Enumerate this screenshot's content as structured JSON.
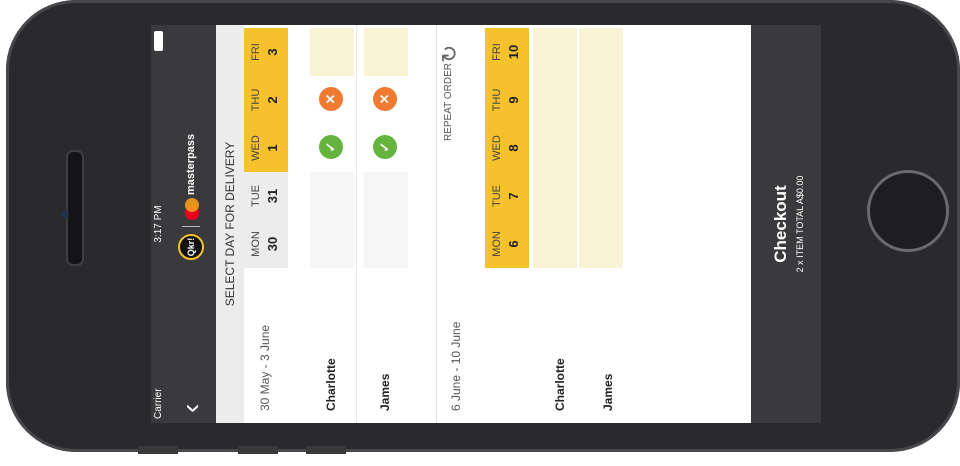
{
  "status": {
    "carrier": "Carrier",
    "time": "3:17 PM"
  },
  "nav": {
    "back_icon": "chevron-left-icon",
    "logo_text": "Qkr!",
    "brand": "masterpass"
  },
  "header": {
    "title": "SELECT DAY FOR DELIVERY"
  },
  "week1": {
    "range": "30 May - 3 June",
    "days": [
      {
        "name": "MON",
        "date": "30"
      },
      {
        "name": "TUE",
        "date": "31"
      },
      {
        "name": "WED",
        "date": "1"
      },
      {
        "name": "THU",
        "date": "2"
      },
      {
        "name": "FRI",
        "date": "3"
      }
    ],
    "rows": [
      {
        "name": "Charlotte"
      },
      {
        "name": "James"
      }
    ]
  },
  "week2": {
    "range": "6 June - 10 June",
    "repeat": "REPEAT ORDER",
    "days": [
      {
        "name": "MON",
        "date": "6"
      },
      {
        "name": "TUE",
        "date": "7"
      },
      {
        "name": "WED",
        "date": "8"
      },
      {
        "name": "THU",
        "date": "9"
      },
      {
        "name": "FRI",
        "date": "10"
      }
    ],
    "rows": [
      {
        "name": "Charlotte"
      },
      {
        "name": "James"
      }
    ]
  },
  "checkout": {
    "title": "Checkout",
    "summary": "2 x ITEM   TOTAL A$0.00"
  },
  "colors": {
    "accent": "#f5c12c",
    "green": "#64b43d",
    "orange": "#f07a32",
    "bar": "#3a3a3d"
  }
}
